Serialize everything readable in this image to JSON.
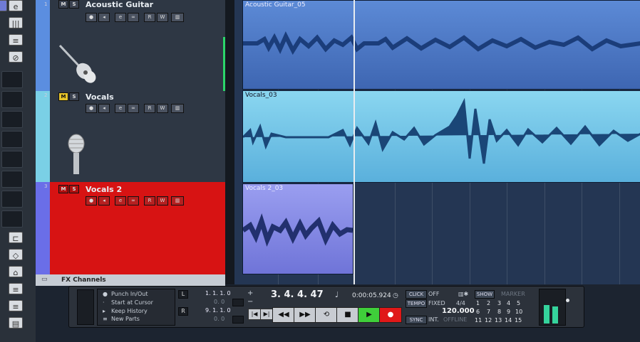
{
  "tracks": [
    {
      "number": "1",
      "name": "Acoustic Guitar",
      "mute": "M",
      "solo": "S",
      "color": "#5b8ee0"
    },
    {
      "number": "2",
      "name": "Vocals",
      "mute": "M",
      "solo": "S",
      "color": "#7ad0e6"
    },
    {
      "number": "3",
      "name": "Vocals 2",
      "mute": "M",
      "solo": "S",
      "color": "#6a6ee8"
    }
  ],
  "track_controls": {
    "record": "●",
    "monitor": "◂",
    "edit": "e",
    "read": "R",
    "write": "W"
  },
  "fx_channels_label": "FX Channels",
  "clips": [
    {
      "label": "Acoustic Guitar_05",
      "color": "#4a78c8"
    },
    {
      "label": "Vocals_03",
      "color": "#60b8e0"
    },
    {
      "label": "Vocals 2_03",
      "color": "#7d82e0"
    }
  ],
  "transport": {
    "options": [
      "Punch In/Out",
      "Start at Cursor",
      "Keep History",
      "New Parts"
    ],
    "left_locator": "1. 1. 1.   0",
    "left_locator_sub": "0.   0",
    "right_locator": "9. 1. 1.   0",
    "right_locator_sub": "0.   0",
    "locator_l": "L",
    "locator_r": "R",
    "position_bars": "3.  4.  4.  47",
    "position_time": "0:00:05.924",
    "click_label": "CLICK",
    "click_value": "OFF",
    "tempo_label": "TEMPO",
    "tempo_mode": "FIXED",
    "signature": "4/4",
    "tempo_value": "120.000",
    "sync_label": "SYNC",
    "sync_value": "INT.",
    "sync_status": "OFFLINE",
    "show_label": "SHOW",
    "marker_label": "MARKER",
    "markers": [
      "1",
      "2",
      "3",
      "4",
      "5",
      "6",
      "7",
      "8",
      "9",
      "10",
      "11",
      "12",
      "13",
      "14",
      "15"
    ],
    "plus": "+",
    "minus": "−"
  },
  "colors": {
    "selected_track": "#d71313",
    "play": "#3fcf3a",
    "record": "#e01818"
  }
}
